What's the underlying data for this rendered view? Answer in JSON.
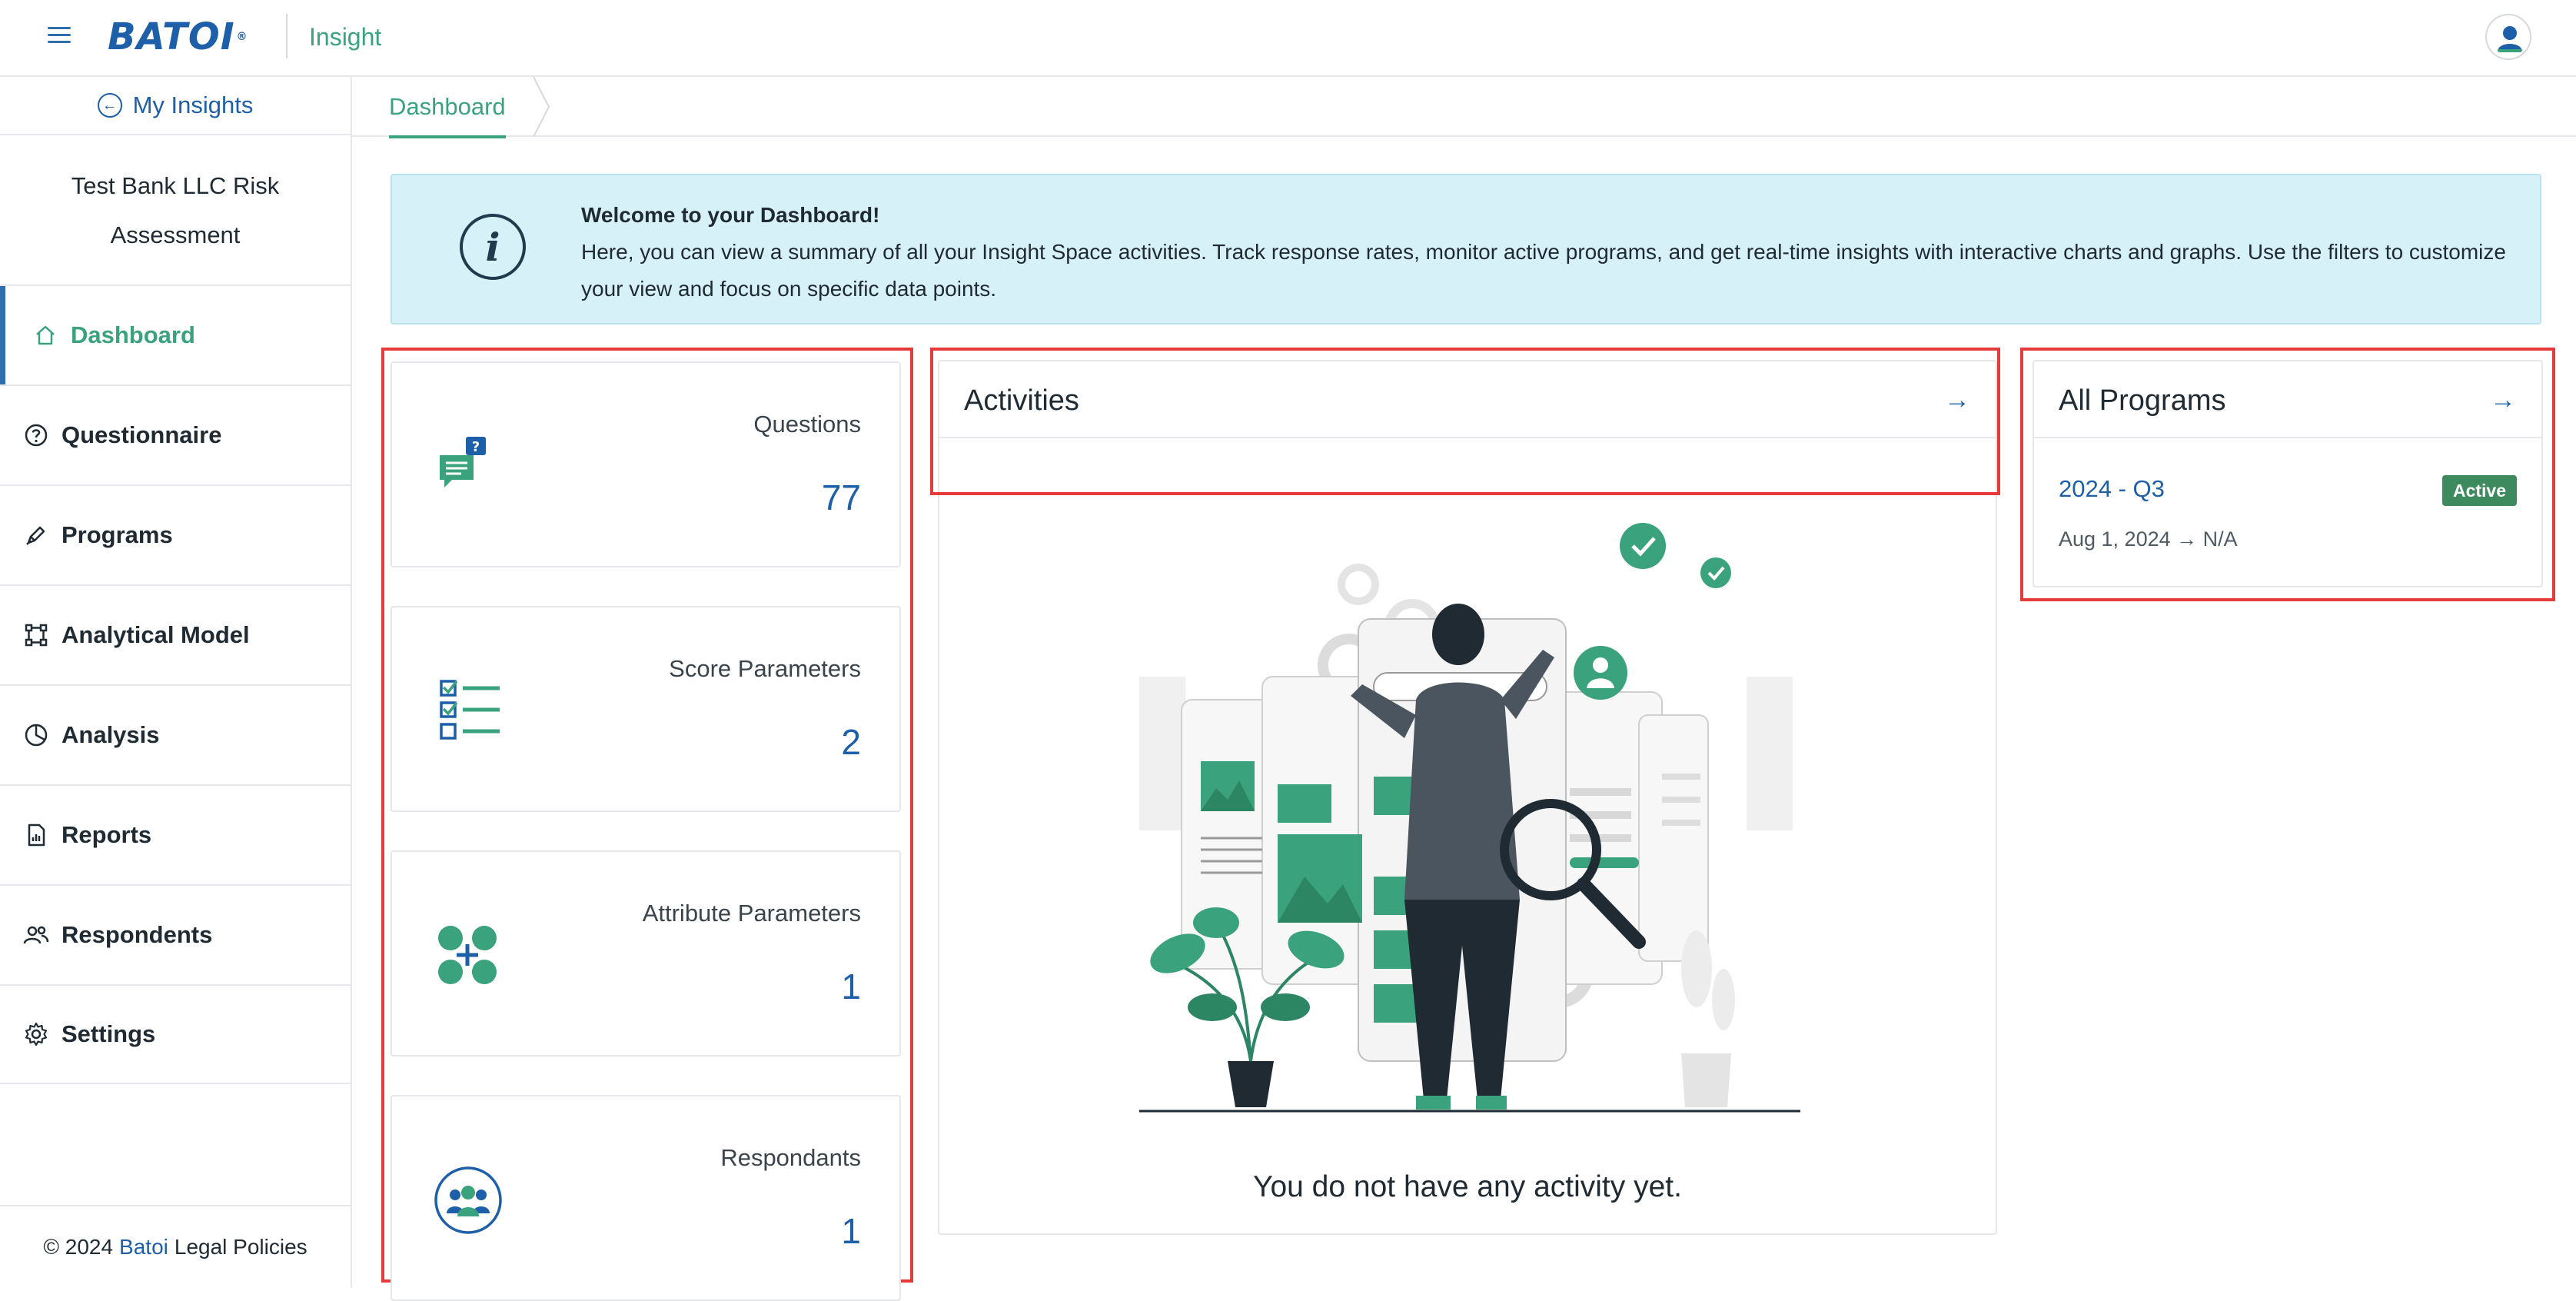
{
  "header": {
    "logo_text": "BATOI",
    "app_name": "Insight",
    "registered_mark": "®"
  },
  "sidebar": {
    "back_label": "My Insights",
    "org_name": "Test Bank LLC Risk Assessment",
    "items": [
      {
        "label": "Dashboard",
        "icon": "home-icon",
        "active": true
      },
      {
        "label": "Questionnaire",
        "icon": "help-circle-icon"
      },
      {
        "label": "Programs",
        "icon": "pen-icon"
      },
      {
        "label": "Analytical Model",
        "icon": "model-icon"
      },
      {
        "label": "Analysis",
        "icon": "pie-chart-icon"
      },
      {
        "label": "Reports",
        "icon": "report-icon"
      },
      {
        "label": "Respondents",
        "icon": "users-icon"
      },
      {
        "label": "Settings",
        "icon": "gear-icon"
      }
    ],
    "footer": {
      "copyright": "© 2024",
      "brand": "Batoi",
      "policies": "Legal Policies"
    }
  },
  "tabs": [
    {
      "label": "Dashboard",
      "active": true
    }
  ],
  "banner": {
    "title": "Welcome to your Dashboard!",
    "text": "Here, you can view a summary of all your Insight Space activities. Track response rates, monitor active programs, and get real-time insights with interactive charts and graphs. Use the filters to customize your view and focus on specific data points."
  },
  "stats": [
    {
      "label": "Questions",
      "value": "77",
      "icon": "questions-chat-icon"
    },
    {
      "label": "Score Parameters",
      "value": "2",
      "icon": "checklist-icon"
    },
    {
      "label": "Attribute Parameters",
      "value": "1",
      "icon": "attributes-icon"
    },
    {
      "label": "Respondants",
      "value": "1",
      "icon": "respondents-group-icon"
    }
  ],
  "activities": {
    "title": "Activities",
    "empty_message": "You do not have any activity yet."
  },
  "programs": {
    "title": "All Programs",
    "items": [
      {
        "name": "2024 - Q3",
        "status": "Active",
        "start": "Aug 1, 2024",
        "end": "N/A"
      }
    ]
  },
  "colors": {
    "brand_blue": "#1d5fa8",
    "accent_green": "#3aa37d",
    "banner_bg": "#d7f1f9",
    "badge_green": "#3d8a5e",
    "highlight_red": "#e53b3b"
  }
}
